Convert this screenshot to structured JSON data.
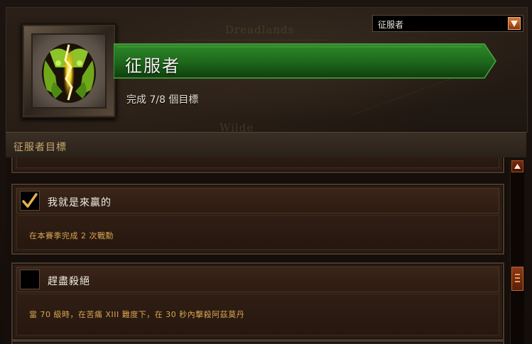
{
  "header": {
    "title": "征服者",
    "progress": "完成 7/8 個目標",
    "map_labels": [
      "Dreadlands",
      "Wilde"
    ]
  },
  "filter": {
    "selected": "征服者"
  },
  "section": {
    "title": "征服者目標"
  },
  "objectives": [
    {
      "title": "我就是來贏的",
      "description": "在本賽季完成 2 次戰勳",
      "completed": true
    },
    {
      "title": "趕盡殺絕",
      "description": "當 70 級時，在苦痛 XIII 難度下，在 30 秒內擊殺阿茲莫丹",
      "completed": false
    }
  ],
  "colors": {
    "banner_green": "#1f6a1c",
    "objective_text": "#d9a650",
    "section_text": "#c8a870"
  },
  "icons": {
    "dropdown": "chevron-down-icon",
    "checked": "checkmark-icon",
    "scroll_up": "arrow-up-icon"
  }
}
